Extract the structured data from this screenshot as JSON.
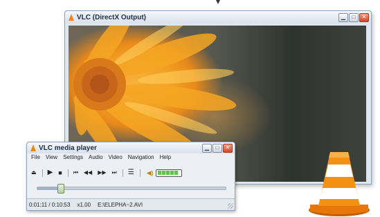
{
  "output_window": {
    "title": "VLC (DirectX Output)",
    "buttons": {
      "minimize": "▁",
      "maximize": "□",
      "close": "✕"
    }
  },
  "player_window": {
    "title": "VLC media player",
    "buttons": {
      "minimize": "▁",
      "maximize": "□",
      "close": "✕"
    },
    "menu": [
      "File",
      "View",
      "Settings",
      "Audio",
      "Video",
      "Navigation",
      "Help"
    ],
    "controls": {
      "eject_icon": "eject-icon",
      "play_icon": "play-icon",
      "stop_icon": "stop-icon",
      "previous_icon": "skip-previous-icon",
      "rewind_icon": "rewind-icon",
      "forward_icon": "fast-forward-icon",
      "next_icon": "skip-next-icon",
      "playlist_icon": "playlist-icon",
      "speaker_icon": "speaker-icon"
    },
    "volume_level": 1.0,
    "seek_position": 0.12,
    "status": {
      "time": "0:01:11 / 0:10:53",
      "speed": "x1.00",
      "file": "E:\\ELEPHA~2.AVI"
    }
  },
  "colors": {
    "accent_orange": "#f08a0c",
    "close_red": "#d4461f",
    "volume_green": "#5cc54a"
  }
}
